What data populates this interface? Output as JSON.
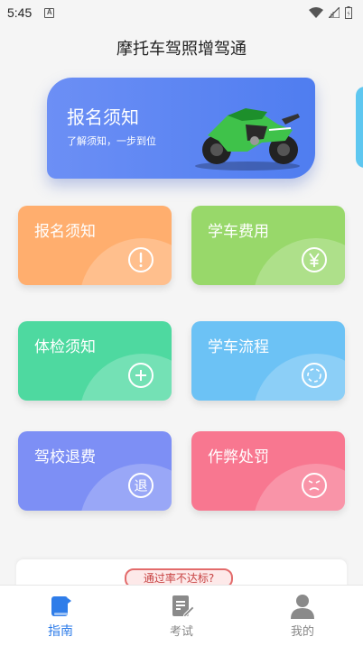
{
  "status_bar": {
    "time": "5:45",
    "notif": "A"
  },
  "app": {
    "title": "摩托车驾照增驾通"
  },
  "banner": {
    "title": "报名须知",
    "subtitle": "了解须知，一步到位"
  },
  "cards": [
    {
      "label": "报名须知",
      "icon": "exclamation-icon",
      "color": "#ffae6e"
    },
    {
      "label": "学车费用",
      "icon": "yen-icon",
      "color": "#98d86a"
    },
    {
      "label": "体检须知",
      "icon": "plus-icon",
      "color": "#4ed9a0"
    },
    {
      "label": "学车流程",
      "icon": "flow-icon",
      "color": "#6cc2f5"
    },
    {
      "label": "驾校退费",
      "icon": "refund-icon",
      "glyph": "退",
      "color": "#7d8ff5"
    },
    {
      "label": "作弊处罚",
      "icon": "angry-face-icon",
      "color": "#f87790"
    }
  ],
  "notice": {
    "badge": "通过率不达标?"
  },
  "tabbar": {
    "items": [
      {
        "label": "指南",
        "icon": "book-icon",
        "active": true
      },
      {
        "label": "考试",
        "icon": "edit-doc-icon",
        "active": false
      },
      {
        "label": "我的",
        "icon": "user-icon",
        "active": false
      }
    ],
    "accent": "#2f7de9"
  }
}
